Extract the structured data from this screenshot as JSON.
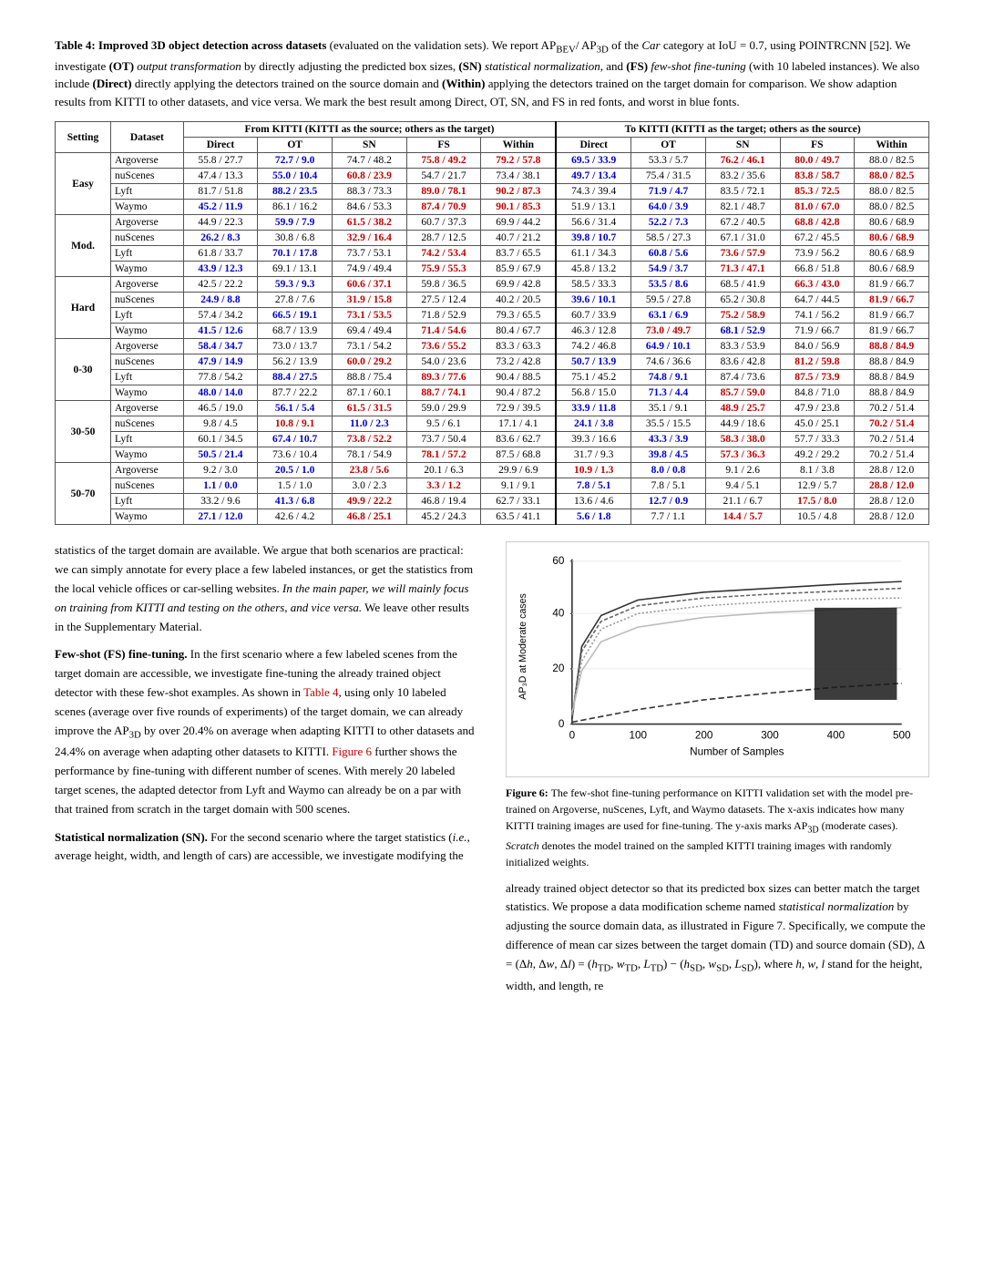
{
  "caption": {
    "label": "Table 4:",
    "title": "Improved 3D object detection across datasets",
    "desc": " (evaluated on the validation sets). We report AP",
    "sub1": "BEV",
    "slash": "/ AP",
    "sub2": "3D",
    "desc2": " of the ",
    "italic1": "Car",
    "desc3": " category at IoU = 0.7, using P",
    "smallcap": "OINT",
    "desc4": "RCNN [52]. We investigate (OT) ",
    "bold1": "output transformation",
    "desc5": " by directly adjusting the predicted box sizes, (SN) ",
    "bold2": "statistical normalization",
    "desc6": ", and (FS) ",
    "bold3": "few-shot fine-tuning",
    "desc7": " (with 10 labeled instances). We also include (Direct) directly applying the detectors trained on the source domain and (Within) applying the detectors trained on the target domain for comparison. We show adaption results from KITTI to other datasets, and vice versa. We mark the best result among Direct, OT, SN, and FS in red fonts, and worst in blue fonts."
  },
  "table": {
    "header_from": "From KITTI (KITTI as the source; others as the target)",
    "header_to": "To KITTI (KITTI as the target; others as the source)",
    "cols": [
      "Direct",
      "OT",
      "SN",
      "FS",
      "Within",
      "Direct",
      "OT",
      "SN",
      "FS",
      "Within"
    ],
    "groups": [
      {
        "setting": "Easy",
        "rows": [
          {
            "dataset": "Argoverse",
            "vals": [
              "55.8 / 27.7",
              "72.7 / 9.0",
              "74.7 / 48.2",
              "75.8 / 49.2",
              "79.2 / 57.8",
              "69.5 / 33.9",
              "53.3 / 5.7",
              "76.2 / 46.1",
              "80.0 / 49.7",
              "88.0 / 82.5"
            ],
            "red": [
              3,
              4,
              7,
              8
            ],
            "blue": [
              1,
              5
            ]
          },
          {
            "dataset": "nuScenes",
            "vals": [
              "47.4 / 13.3",
              "55.0 / 10.4",
              "60.8 / 23.9",
              "54.7 / 21.7",
              "73.4 / 38.1",
              "49.7 / 13.4",
              "75.4 / 31.5",
              "83.2 / 35.6",
              "83.8 / 58.7",
              "88.0 / 82.5"
            ],
            "red": [
              2,
              8,
              9
            ],
            "blue": [
              1,
              5
            ]
          },
          {
            "dataset": "Lyft",
            "vals": [
              "81.7 / 51.8",
              "88.2 / 23.5",
              "88.3 / 73.3",
              "89.0 / 78.1",
              "90.2 / 87.3",
              "74.3 / 39.4",
              "71.9 / 4.7",
              "83.5 / 72.1",
              "85.3 / 72.5",
              "88.0 / 82.5"
            ],
            "red": [
              3,
              4,
              8
            ],
            "blue": [
              1,
              6
            ]
          },
          {
            "dataset": "Waymo",
            "vals": [
              "45.2 / 11.9",
              "86.1 / 16.2",
              "84.6 / 53.3",
              "87.4 / 70.9",
              "90.1 / 85.3",
              "51.9 / 13.1",
              "64.0 / 3.9",
              "82.1 / 48.7",
              "81.0 / 67.0",
              "88.0 / 82.5"
            ],
            "red": [
              3,
              4,
              8
            ],
            "blue": [
              0,
              6
            ]
          }
        ]
      },
      {
        "setting": "Mod.",
        "rows": [
          {
            "dataset": "Argoverse",
            "vals": [
              "44.9 / 22.3",
              "59.9 / 7.9",
              "61.5 / 38.2",
              "60.7 / 37.3",
              "69.9 / 44.2",
              "56.6 / 31.4",
              "52.2 / 7.3",
              "67.2 / 40.5",
              "68.8 / 42.8",
              "80.6 / 68.9"
            ],
            "red": [
              2,
              8
            ],
            "blue": [
              1,
              6
            ]
          },
          {
            "dataset": "nuScenes",
            "vals": [
              "26.2 / 8.3",
              "30.8 / 6.8",
              "32.9 / 16.4",
              "28.7 / 12.5",
              "40.7 / 21.2",
              "39.8 / 10.7",
              "58.5 / 27.3",
              "67.1 / 31.0",
              "67.2 / 45.5",
              "80.6 / 68.9"
            ],
            "red": [
              2,
              9
            ],
            "blue": [
              0,
              5
            ]
          },
          {
            "dataset": "Lyft",
            "vals": [
              "61.8 / 33.7",
              "70.1 / 17.8",
              "73.7 / 53.1",
              "74.2 / 53.4",
              "83.7 / 65.5",
              "61.1 / 34.3",
              "60.8 / 5.6",
              "73.6 / 57.9",
              "73.9 / 56.2",
              "80.6 / 68.9"
            ],
            "red": [
              3,
              7
            ],
            "blue": [
              1,
              6
            ]
          },
          {
            "dataset": "Waymo",
            "vals": [
              "43.9 / 12.3",
              "69.1 / 13.1",
              "74.9 / 49.4",
              "75.9 / 55.3",
              "85.9 / 67.9",
              "45.8 / 13.2",
              "54.9 / 3.7",
              "71.3 / 47.1",
              "66.8 / 51.8",
              "80.6 / 68.9"
            ],
            "red": [
              3,
              7
            ],
            "blue": [
              0,
              6
            ]
          }
        ]
      },
      {
        "setting": "Hard",
        "rows": [
          {
            "dataset": "Argoverse",
            "vals": [
              "42.5 / 22.2",
              "59.3 / 9.3",
              "60.6 / 37.1",
              "59.8 / 36.5",
              "69.9 / 42.8",
              "58.5 / 33.3",
              "53.5 / 8.6",
              "68.5 / 41.9",
              "66.3 / 43.0",
              "81.9 / 66.7"
            ],
            "red": [
              2,
              8
            ],
            "blue": [
              1,
              6
            ]
          },
          {
            "dataset": "nuScenes",
            "vals": [
              "24.9 / 8.8",
              "27.8 / 7.6",
              "31.9 / 15.8",
              "27.5 / 12.4",
              "40.2 / 20.5",
              "39.6 / 10.1",
              "59.5 / 27.8",
              "65.2 / 30.8",
              "64.7 / 44.5",
              "81.9 / 66.7"
            ],
            "red": [
              2,
              9
            ],
            "blue": [
              0,
              5
            ]
          },
          {
            "dataset": "Lyft",
            "vals": [
              "57.4 / 34.2",
              "66.5 / 19.1",
              "73.1 / 53.5",
              "71.8 / 52.9",
              "79.3 / 65.5",
              "60.7 / 33.9",
              "63.1 / 6.9",
              "75.2 / 58.9",
              "74.1 / 56.2",
              "81.9 / 66.7"
            ],
            "red": [
              2,
              7
            ],
            "blue": [
              1,
              6
            ]
          },
          {
            "dataset": "Waymo",
            "vals": [
              "41.5 / 12.6",
              "68.7 / 13.9",
              "69.4 / 49.4",
              "71.4 / 54.6",
              "80.4 / 67.7",
              "46.3 / 12.8",
              "73.0 / 49.7",
              "68.1 / 52.9",
              "71.9 / 66.7",
              "81.9 / 66.7"
            ],
            "red": [
              3,
              6
            ],
            "blue": [
              0,
              7
            ]
          }
        ]
      },
      {
        "setting": "0-30",
        "rows": [
          {
            "dataset": "Argoverse",
            "vals": [
              "58.4 / 34.7",
              "73.0 / 13.7",
              "73.1 / 54.2",
              "73.6 / 55.2",
              "83.3 / 63.3",
              "74.2 / 46.8",
              "64.9 / 10.1",
              "83.3 / 53.9",
              "84.0 / 56.9",
              "88.8 / 84.9"
            ],
            "red": [
              3,
              9
            ],
            "blue": [
              0,
              6
            ]
          },
          {
            "dataset": "nuScenes",
            "vals": [
              "47.9 / 14.9",
              "56.2 / 13.9",
              "60.0 / 29.2",
              "54.0 / 23.6",
              "73.2 / 42.8",
              "50.7 / 13.9",
              "74.6 / 36.6",
              "83.6 / 42.8",
              "81.2 / 59.8",
              "88.8 / 84.9"
            ],
            "red": [
              2,
              8
            ],
            "blue": [
              0,
              5
            ]
          },
          {
            "dataset": "Lyft",
            "vals": [
              "77.8 / 54.2",
              "88.4 / 27.5",
              "88.8 / 75.4",
              "89.3 / 77.6",
              "90.4 / 88.5",
              "75.1 / 45.2",
              "74.8 / 9.1",
              "87.4 / 73.6",
              "87.5 / 73.9",
              "88.8 / 84.9"
            ],
            "red": [
              3,
              8
            ],
            "blue": [
              1,
              6
            ]
          },
          {
            "dataset": "Waymo",
            "vals": [
              "48.0 / 14.0",
              "87.7 / 22.2",
              "87.1 / 60.1",
              "88.7 / 74.1",
              "90.4 / 87.2",
              "56.8 / 15.0",
              "71.3 / 4.4",
              "85.7 / 59.0",
              "84.8 / 71.0",
              "88.8 / 84.9"
            ],
            "red": [
              3,
              7
            ],
            "blue": [
              0,
              6
            ]
          }
        ]
      },
      {
        "setting": "30-50",
        "rows": [
          {
            "dataset": "Argoverse",
            "vals": [
              "46.5 / 19.0",
              "56.1 / 5.4",
              "61.5 / 31.5",
              "59.0 / 29.9",
              "72.9 / 39.5",
              "33.9 / 11.8",
              "35.1 / 9.1",
              "48.9 / 25.7",
              "47.9 / 23.8",
              "70.2 / 51.4"
            ],
            "red": [
              2,
              7
            ],
            "blue": [
              1,
              5
            ]
          },
          {
            "dataset": "nuScenes",
            "vals": [
              "9.8 / 4.5",
              "10.8 / 9.1",
              "11.0 / 2.3",
              "9.5 / 6.1",
              "17.1 / 4.1",
              "24.1 / 3.8",
              "35.5 / 15.5",
              "44.9 / 18.6",
              "45.0 / 25.1",
              "70.2 / 51.4"
            ],
            "red": [
              1,
              9
            ],
            "blue": [
              2,
              5
            ]
          },
          {
            "dataset": "Lyft",
            "vals": [
              "60.1 / 34.5",
              "67.4 / 10.7",
              "73.8 / 52.2",
              "73.7 / 50.4",
              "83.6 / 62.7",
              "39.3 / 16.6",
              "43.3 / 3.9",
              "58.3 / 38.0",
              "57.7 / 33.3",
              "70.2 / 51.4"
            ],
            "red": [
              2,
              7
            ],
            "blue": [
              1,
              6
            ]
          },
          {
            "dataset": "Waymo",
            "vals": [
              "50.5 / 21.4",
              "73.6 / 10.4",
              "78.1 / 54.9",
              "78.1 / 57.2",
              "87.5 / 68.8",
              "31.7 / 9.3",
              "39.8 / 4.5",
              "57.3 / 36.3",
              "49.2 / 29.2",
              "70.2 / 51.4"
            ],
            "red": [
              3,
              7
            ],
            "blue": [
              0,
              6
            ]
          }
        ]
      },
      {
        "setting": "50-70",
        "rows": [
          {
            "dataset": "Argoverse",
            "vals": [
              "9.2 / 3.0",
              "20.5 / 1.0",
              "23.8 / 5.6",
              "20.1 / 6.3",
              "29.9 / 6.9",
              "10.9 / 1.3",
              "8.0 / 0.8",
              "9.1 / 2.6",
              "8.1 / 3.8",
              "28.8 / 12.0"
            ],
            "red": [
              2,
              5
            ],
            "blue": [
              1,
              6
            ]
          },
          {
            "dataset": "nuScenes",
            "vals": [
              "1.1 / 0.0",
              "1.5 / 1.0",
              "3.0 / 2.3",
              "3.3 / 1.2",
              "9.1 / 9.1",
              "7.8 / 5.1",
              "7.8 / 5.1",
              "9.4 / 5.1",
              "12.9 / 5.7",
              "28.8 / 12.0"
            ],
            "red": [
              3,
              9
            ],
            "blue": [
              0,
              5
            ]
          },
          {
            "dataset": "Lyft",
            "vals": [
              "33.2 / 9.6",
              "41.3 / 6.8",
              "49.9 / 22.2",
              "46.8 / 19.4",
              "62.7 / 33.1",
              "13.6 / 4.6",
              "12.7 / 0.9",
              "21.1 / 6.7",
              "17.5 / 8.0",
              "28.8 / 12.0"
            ],
            "red": [
              2,
              8
            ],
            "blue": [
              1,
              6
            ]
          },
          {
            "dataset": "Waymo",
            "vals": [
              "27.1 / 12.0",
              "42.6 / 4.2",
              "46.8 / 25.1",
              "45.2 / 24.3",
              "63.5 / 41.1",
              "5.6 / 1.8",
              "7.7 / 1.1",
              "14.4 / 5.7",
              "10.5 / 4.8",
              "28.8 / 12.0"
            ],
            "red": [
              2,
              7
            ],
            "blue": [
              0,
              5
            ]
          }
        ]
      }
    ]
  },
  "body": {
    "para1": "statistics of the target domain are available. We argue that both scenarios are practical: we can simply annotate for every place a few labeled instances, or get the statistics from the local vehicle offices or car-selling websites.",
    "para1_italic": "In the main paper, we will mainly focus on training from KITTI and testing on the others, and vice versa.",
    "para1_end": "We leave other results in the Supplementary Material.",
    "para2_heading": "Few-shot (FS) fine-tuning.",
    "para2": "In the first scenario where a few labeled scenes from the target domain are accessible, we investigate fine-tuning the already trained object detector with these few-shot examples. As shown in Table 4, using only 10 labeled scenes (average over five rounds of experiments) of the target domain, we can already improve the AP",
    "para2_sub": "3D",
    "para2_cont": "by over 20.4% on average when adapting KITTI to other datasets and 24.4% on average when adapting other datasets to KITTI. Figure 6 further shows the performance by fine-tuning with different number of scenes. With merely 20 labeled target scenes, the adapted detector from Lyft and Waymo can already be on a par with that trained from scratch in the target domain with 500 scenes.",
    "para3_heading": "Statistical normalization (SN).",
    "para3": "For the second scenario where the target statistics (i.e., average height, width, and length of cars) are accessible, we investigate modifying the",
    "right_para1": "already trained object detector so that its predicted box sizes can better match the target statistics. We propose a data modification scheme named",
    "right_para1_italic": "statistical normalization",
    "right_para1_cont": "by adjusting the source domain data, as illustrated in Figure 7. Specifically, we compute the difference of mean car sizes between the target domain (TD) and source domain (SD), Δ = (Δh, Δw, Δl) = (h",
    "right_formula": "TD",
    "right_para1_end": ", w",
    "right_formula2": "TD",
    "right_para1_end2": ", L",
    "right_formula3": "TD",
    "right_para1_end3": ") − (h",
    "right_formula4": "SD",
    "right_para1_end4": ", w",
    "right_formula5": "SD",
    "right_para1_end5": ", L",
    "right_formula6": "SD",
    "right_para1_end6": "), where h, w, l stand for the height, width, and length, re"
  },
  "figure": {
    "caption_label": "Figure 6:",
    "caption_text": "The few-shot fine-tuning performance on KITTI validation set with the model pre-trained on Argoverse, nuScenes, Lyft, and Waymo datasets. The x-axis indicates how many KITTI training images are used for fine-tuning. The y-axis marks AP",
    "caption_sub": "3D",
    "caption_end": " (moderate cases). Scratch denotes the model trained on the sampled KITTI training images with randomly initialized weights.",
    "x_label": "Number of Samples",
    "y_label": "AP₃D at Moderate cases",
    "y_max": 60,
    "y_ticks": [
      0,
      20,
      40,
      60
    ],
    "x_ticks": [
      0,
      100,
      200,
      300,
      400,
      500
    ]
  }
}
